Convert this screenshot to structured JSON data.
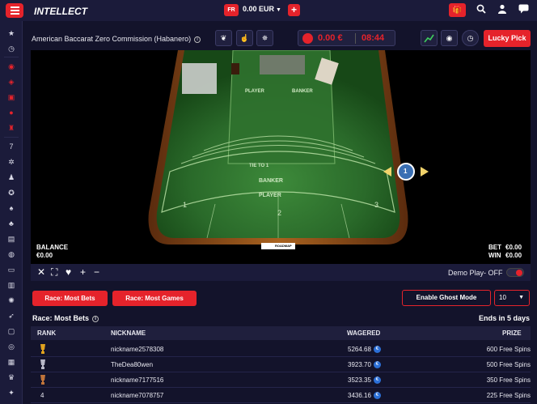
{
  "topbar": {
    "brand": "INTELLECT",
    "flag_label": "FR",
    "balance": "0.00 EUR",
    "plus": "+"
  },
  "game": {
    "title": "American Baccarat Zero Commission (Habanero)",
    "wallet_amount": "0.00 €",
    "timer": "08:44",
    "lucky_pick": "Lucky Pick",
    "balance_label": "BALANCE",
    "balance_value": "€0.00",
    "bet_label": "BET",
    "bet_value": "€0.00",
    "win_label": "WIN",
    "win_value": "€0.00",
    "table_player": "PLAYER",
    "table_banker": "BANKER",
    "table_tie": "TIE TO 1",
    "seat_numbers": [
      "1",
      "2",
      "3"
    ],
    "roadmap": "ROADMAP",
    "chip_value": "1",
    "demo_label": "Demo Play- OFF"
  },
  "race": {
    "tab_most_bets": "Race: Most Bets",
    "tab_most_games": "Race: Most Games",
    "ghost_mode": "Enable Ghost Mode",
    "select_value": "10",
    "title": "Race: Most Bets",
    "ends": "Ends in 5 days",
    "headers": {
      "rank": "RANK",
      "nickname": "NICKNAME",
      "wagered": "WAGERED",
      "prize": "PRIZE"
    },
    "rows": [
      {
        "rank": "",
        "nickname": "nickname2578308",
        "wagered": "5264.68",
        "prize": "600 Free Spins",
        "trophy": "gold"
      },
      {
        "rank": "",
        "nickname": "TheDea80wen",
        "wagered": "3923.70",
        "prize": "500 Free Spins",
        "trophy": "silver"
      },
      {
        "rank": "",
        "nickname": "nickname7177516",
        "wagered": "3523.35",
        "prize": "350 Free Spins",
        "trophy": "bronze"
      },
      {
        "rank": "4",
        "nickname": "nickname7078757",
        "wagered": "3436.16",
        "prize": "225 Free Spins",
        "trophy": ""
      }
    ]
  }
}
